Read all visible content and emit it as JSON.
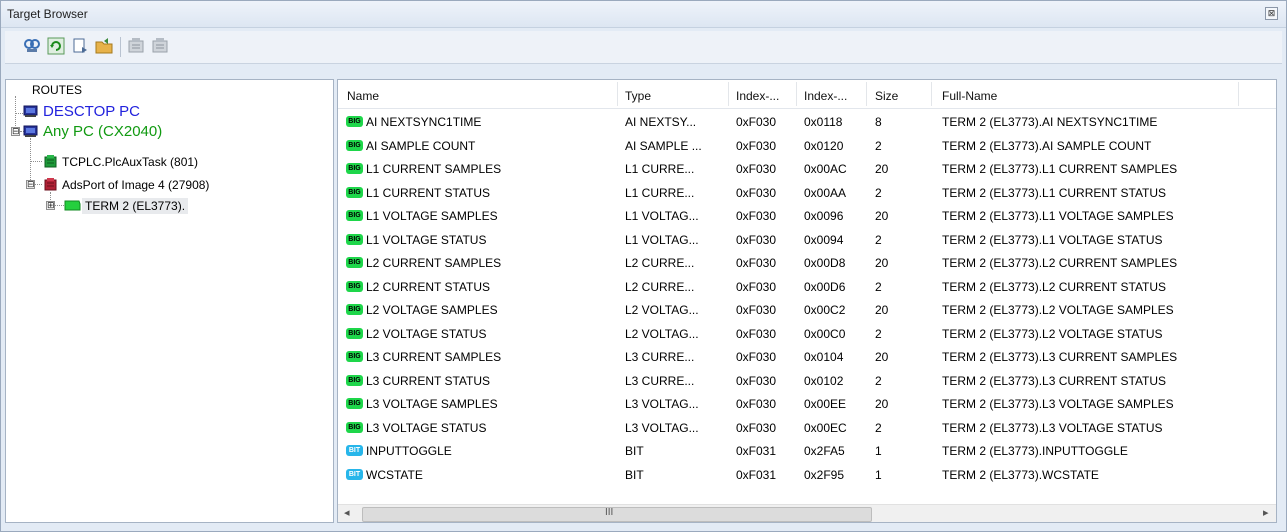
{
  "window": {
    "title": "Target Browser",
    "close_glyph": "⊠"
  },
  "toolbar": {
    "buttons": [
      {
        "icon": "find-icon"
      },
      {
        "icon": "refresh-icon"
      },
      {
        "icon": "add-watch-icon"
      },
      {
        "icon": "open-folder-icon"
      },
      {
        "icon": "disabled-grid-icon"
      },
      {
        "icon": "disabled-grid-icon-2"
      }
    ]
  },
  "tree": {
    "root": "ROUTES",
    "nodes": [
      {
        "label": "DESCTOP PC",
        "color": "#2222dd"
      },
      {
        "label": "Any PC (CX2040)",
        "color": "#119a11"
      },
      {
        "label": "TCPLC.PlcAuxTask (801)"
      },
      {
        "label": "AdsPort of Image 4 (27908)"
      },
      {
        "label": "TERM 2 (EL3773)."
      }
    ],
    "expanders": [
      "⊟",
      "⊟",
      "⊞"
    ]
  },
  "table": {
    "columns": [
      "Name",
      "Type",
      "Index-...",
      "Index-...",
      "Size",
      "Full-Name"
    ],
    "rows": [
      {
        "badge": "BIG",
        "name": "AI NEXTSYNC1TIME",
        "type": "AI NEXTSY...",
        "igrp": "0xF030",
        "ioff": "0x0118",
        "size": "8",
        "full": "TERM 2 (EL3773).AI NEXTSYNC1TIME"
      },
      {
        "badge": "BIG",
        "name": "AI SAMPLE COUNT",
        "type": "AI SAMPLE ...",
        "igrp": "0xF030",
        "ioff": "0x0120",
        "size": "2",
        "full": "TERM 2 (EL3773).AI SAMPLE COUNT"
      },
      {
        "badge": "BIG",
        "name": "L1 CURRENT SAMPLES",
        "type": "L1 CURRE...",
        "igrp": "0xF030",
        "ioff": "0x00AC",
        "size": "20",
        "full": "TERM 2 (EL3773).L1 CURRENT SAMPLES"
      },
      {
        "badge": "BIG",
        "name": "L1 CURRENT STATUS",
        "type": "L1 CURRE...",
        "igrp": "0xF030",
        "ioff": "0x00AA",
        "size": "2",
        "full": "TERM 2 (EL3773).L1 CURRENT STATUS"
      },
      {
        "badge": "BIG",
        "name": "L1 VOLTAGE SAMPLES",
        "type": "L1 VOLTAG...",
        "igrp": "0xF030",
        "ioff": "0x0096",
        "size": "20",
        "full": "TERM 2 (EL3773).L1 VOLTAGE SAMPLES"
      },
      {
        "badge": "BIG",
        "name": "L1 VOLTAGE STATUS",
        "type": "L1 VOLTAG...",
        "igrp": "0xF030",
        "ioff": "0x0094",
        "size": "2",
        "full": "TERM 2 (EL3773).L1 VOLTAGE STATUS"
      },
      {
        "badge": "BIG",
        "name": "L2 CURRENT SAMPLES",
        "type": "L2 CURRE...",
        "igrp": "0xF030",
        "ioff": "0x00D8",
        "size": "20",
        "full": "TERM 2 (EL3773).L2 CURRENT SAMPLES"
      },
      {
        "badge": "BIG",
        "name": "L2 CURRENT STATUS",
        "type": "L2 CURRE...",
        "igrp": "0xF030",
        "ioff": "0x00D6",
        "size": "2",
        "full": "TERM 2 (EL3773).L2 CURRENT STATUS"
      },
      {
        "badge": "BIG",
        "name": "L2 VOLTAGE SAMPLES",
        "type": "L2 VOLTAG...",
        "igrp": "0xF030",
        "ioff": "0x00C2",
        "size": "20",
        "full": "TERM 2 (EL3773).L2 VOLTAGE SAMPLES"
      },
      {
        "badge": "BIG",
        "name": "L2 VOLTAGE STATUS",
        "type": "L2 VOLTAG...",
        "igrp": "0xF030",
        "ioff": "0x00C0",
        "size": "2",
        "full": "TERM 2 (EL3773).L2 VOLTAGE STATUS"
      },
      {
        "badge": "BIG",
        "name": "L3 CURRENT SAMPLES",
        "type": "L3 CURRE...",
        "igrp": "0xF030",
        "ioff": "0x0104",
        "size": "20",
        "full": "TERM 2 (EL3773).L3 CURRENT SAMPLES"
      },
      {
        "badge": "BIG",
        "name": "L3 CURRENT STATUS",
        "type": "L3 CURRE...",
        "igrp": "0xF030",
        "ioff": "0x0102",
        "size": "2",
        "full": "TERM 2 (EL3773).L3 CURRENT STATUS"
      },
      {
        "badge": "BIG",
        "name": "L3 VOLTAGE SAMPLES",
        "type": "L3 VOLTAG...",
        "igrp": "0xF030",
        "ioff": "0x00EE",
        "size": "20",
        "full": "TERM 2 (EL3773).L3 VOLTAGE SAMPLES"
      },
      {
        "badge": "BIG",
        "name": "L3 VOLTAGE STATUS",
        "type": "L3 VOLTAG...",
        "igrp": "0xF030",
        "ioff": "0x00EC",
        "size": "2",
        "full": "TERM 2 (EL3773).L3 VOLTAGE STATUS"
      },
      {
        "badge": "BIT",
        "name": "INPUTTOGGLE",
        "type": "BIT",
        "igrp": "0xF031",
        "ioff": "0x2FA5",
        "size": "1",
        "full": "TERM 2 (EL3773).INPUTTOGGLE"
      },
      {
        "badge": "BIT",
        "name": "WCSTATE",
        "type": "BIT",
        "igrp": "0xF031",
        "ioff": "0x2F95",
        "size": "1",
        "full": "TERM 2 (EL3773).WCSTATE"
      }
    ]
  },
  "scrollbar": {
    "left_arrow": "◂",
    "right_arrow": "▸",
    "grip": "III"
  }
}
